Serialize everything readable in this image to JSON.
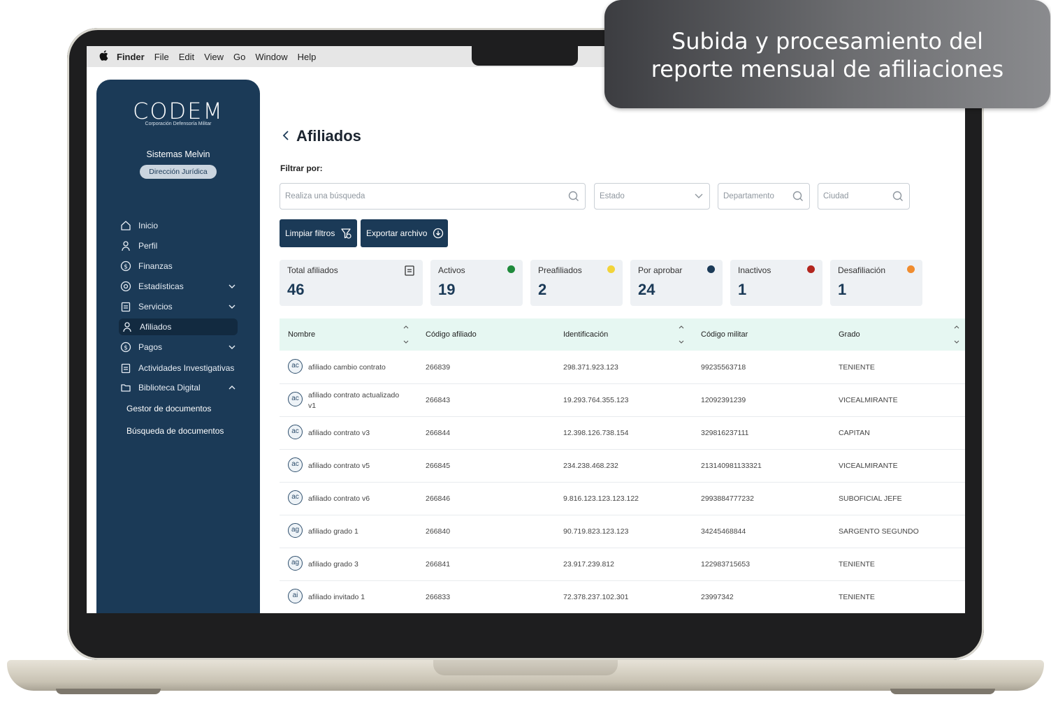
{
  "banner": {
    "line1": "Subida y procesamiento del",
    "line2": "reporte mensual de afiliaciones"
  },
  "menubar": {
    "apple": "",
    "items": [
      "Finder",
      "File",
      "Edit",
      "View",
      "Go",
      "Window",
      "Help"
    ]
  },
  "sidebar": {
    "logo": "CODEM",
    "logo_sub": "Corporación Defensoría Militar",
    "user": "Sistemas Melvin",
    "role": "Dirección Jurídica",
    "items": [
      {
        "label": "Inicio",
        "icon": "home-icon"
      },
      {
        "label": "Perfil",
        "icon": "user-icon"
      },
      {
        "label": "Finanzas",
        "icon": "dollar-icon"
      },
      {
        "label": "Estadísticas",
        "icon": "eye-icon",
        "chevron": "down"
      },
      {
        "label": "Servicios",
        "icon": "clipboard-icon",
        "chevron": "down"
      },
      {
        "label": "Afiliados",
        "icon": "user-icon",
        "active": true
      },
      {
        "label": "Pagos",
        "icon": "dollar-icon",
        "chevron": "down"
      },
      {
        "label": "Actividades Investigativas",
        "icon": "clipboard-icon"
      },
      {
        "label": "Biblioteca Digital",
        "icon": "folder-icon",
        "chevron": "up"
      }
    ],
    "subitems": [
      "Gestor de documentos",
      "Búsqueda de documentos"
    ]
  },
  "page": {
    "title": "Afiliados",
    "filter_label": "Filtrar por:",
    "search_placeholder": "Realiza una búsqueda",
    "estado_placeholder": "Estado",
    "departamento_placeholder": "Departamento",
    "ciudad_placeholder": "Ciudad",
    "clear_button": "Limpiar filtros",
    "export_button": "Exportar archivo"
  },
  "cards": [
    {
      "label": "Total afiliados",
      "value": "46",
      "color": ""
    },
    {
      "label": "Activos",
      "value": "19",
      "color": "#1f8a3b"
    },
    {
      "label": "Preafiliados",
      "value": "2",
      "color": "#f2d43a"
    },
    {
      "label": "Por aprobar",
      "value": "24",
      "color": "#1b3a57"
    },
    {
      "label": "Inactivos",
      "value": "1",
      "color": "#b3261e"
    },
    {
      "label": "Desafiliación",
      "value": "1",
      "color": "#f08c2e"
    }
  ],
  "table": {
    "columns": [
      "Nombre",
      "Código afiliado",
      "Identificación",
      "Código militar",
      "Grado"
    ],
    "rows": [
      {
        "initials": "ac",
        "name": "afiliado cambio contrato",
        "name2": "",
        "codigo": "266839",
        "id": "298.371.923.123",
        "militar": "99235563718",
        "grado": "TENIENTE"
      },
      {
        "initials": "ac",
        "name": "afiliado contrato actualizado",
        "name2": "v1",
        "codigo": "266843",
        "id": "19.293.764.355.123",
        "militar": "12092391239",
        "grado": "VICEALMIRANTE"
      },
      {
        "initials": "ac",
        "name": "afiliado contrato v3",
        "name2": "",
        "codigo": "266844",
        "id": "12.398.126.738.154",
        "militar": "329816237111",
        "grado": "CAPITAN"
      },
      {
        "initials": "ac",
        "name": "afiliado contrato v5",
        "name2": "",
        "codigo": "266845",
        "id": "234.238.468.232",
        "militar": "213140981133321",
        "grado": "VICEALMIRANTE"
      },
      {
        "initials": "ac",
        "name": "afiliado contrato v6",
        "name2": "",
        "codigo": "266846",
        "id": "9.816.123.123.123.122",
        "militar": "2993884777232",
        "grado": "SUBOFICIAL JEFE"
      },
      {
        "initials": "ag",
        "name": "afiliado grado 1",
        "name2": "",
        "codigo": "266840",
        "id": "90.719.823.123.123",
        "militar": "34245468844",
        "grado": "SARGENTO SEGUNDO"
      },
      {
        "initials": "ag",
        "name": "afiliado grado 3",
        "name2": "",
        "codigo": "266841",
        "id": "23.917.239.812",
        "militar": "122983715653",
        "grado": "TENIENTE"
      },
      {
        "initials": "ai",
        "name": "afiliado invitado 1",
        "name2": "",
        "codigo": "266833",
        "id": "72.378.237.102.301",
        "militar": "23997342",
        "grado": "TENIENTE"
      }
    ]
  }
}
